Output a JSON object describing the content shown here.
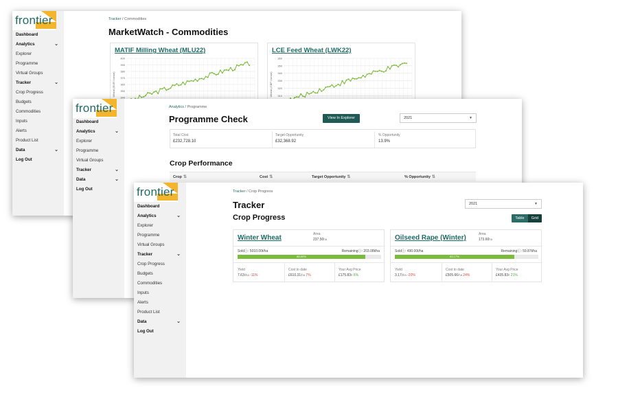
{
  "brand": {
    "logo_text": "frontier"
  },
  "window1": {
    "breadcrumb": {
      "parent": "Tracker",
      "separator": "/",
      "current": "Commodities"
    },
    "title": "MarketWatch - Commodities",
    "charts": [
      {
        "title": "MATIF Milling Wheat (MLU22)",
        "ylabel": "Wheat (EUR / tonne)",
        "yticks": [
          "400",
          "390",
          "380",
          "370",
          "360",
          "350",
          "340",
          "330",
          "320"
        ]
      },
      {
        "title": "LCE Feed Wheat (LWK22)",
        "ylabel": "Wheat (GBP / tonne)",
        "yticks": [
          "360",
          "350",
          "340",
          "330",
          "320",
          "310",
          "300",
          "290"
        ]
      }
    ],
    "nav": [
      {
        "label": "Dashboard",
        "bold": true,
        "chevron": false
      },
      {
        "label": "Analytics",
        "bold": true,
        "chevron": true
      },
      {
        "label": "Explorer",
        "bold": false,
        "chevron": false
      },
      {
        "label": "Programme",
        "bold": false,
        "chevron": false
      },
      {
        "label": "Virtual Groups",
        "bold": false,
        "chevron": false
      },
      {
        "label": "Tracker",
        "bold": true,
        "chevron": true
      },
      {
        "label": "Crop Progress",
        "bold": false,
        "chevron": false
      },
      {
        "label": "Budgets",
        "bold": false,
        "chevron": false
      },
      {
        "label": "Commodities",
        "bold": false,
        "chevron": false
      },
      {
        "label": "Inputs",
        "bold": false,
        "chevron": false
      },
      {
        "label": "Alerts",
        "bold": false,
        "chevron": false
      },
      {
        "label": "Product List",
        "bold": false,
        "chevron": false
      },
      {
        "label": "Data",
        "bold": true,
        "chevron": true
      },
      {
        "label": "Log Out",
        "bold": true,
        "chevron": false
      }
    ]
  },
  "window2": {
    "breadcrumb": {
      "parent": "Analytics",
      "separator": "/",
      "current": "Programme"
    },
    "title": "Programme Check",
    "view_button": "View In Explorer",
    "year_select": "2021",
    "stats": [
      {
        "label": "Total Cost",
        "value": "£232,728.10"
      },
      {
        "label": "Target Opportunity",
        "value": "£32,368.92"
      },
      {
        "label": "% Opportunity",
        "value": "13.9%"
      }
    ],
    "section_title": "Crop Performance",
    "table_headers": [
      "Crop",
      "Cost",
      "Target Opportunity",
      "% Opportunity"
    ],
    "nav": [
      {
        "label": "Dashboard",
        "bold": true,
        "chevron": false
      },
      {
        "label": "Analytics",
        "bold": true,
        "chevron": true
      },
      {
        "label": "Explorer",
        "bold": false,
        "chevron": false
      },
      {
        "label": "Programme",
        "bold": false,
        "chevron": false
      },
      {
        "label": "Virtual Groups",
        "bold": false,
        "chevron": false
      },
      {
        "label": "Tracker",
        "bold": true,
        "chevron": true
      },
      {
        "label": "Data",
        "bold": true,
        "chevron": true
      },
      {
        "label": "Log Out",
        "bold": true,
        "chevron": false
      }
    ]
  },
  "window3": {
    "breadcrumb": {
      "parent": "Tracker",
      "separator": "/",
      "current": "Crop Progress"
    },
    "title": "Tracker",
    "subtitle": "Crop Progress",
    "year_select": "2021",
    "view_toggle": {
      "table": "Table",
      "grid": "Grid"
    },
    "crops": [
      {
        "name": "Winter Wheat",
        "area_label": "Area",
        "area_value": "237.50",
        "area_unit": "ha",
        "sold_label": "Sold",
        "sold_value": ": 5010.00t/ha",
        "remaining_label": "Remaining",
        "remaining_value": ": 203.08t/ha",
        "progress_text": "88.80%",
        "progress": 0.888,
        "metrics": [
          {
            "label": "Yield",
            "value": "7.63",
            "unit": "t/ha",
            "change": "-11%",
            "dir": "neg"
          },
          {
            "label": "Cost to date",
            "value": "£610.31",
            "unit": "/ha",
            "change": "7%",
            "dir": "neg"
          },
          {
            "label": "Your Avg Price",
            "value": "£175.83",
            "unit": "/t",
            "change": "6%",
            "dir": "pos"
          }
        ]
      },
      {
        "name": "Oilseed Rape (Winter)",
        "area_label": "Area",
        "area_value": "173.60",
        "area_unit": "ha",
        "sold_label": "Sold",
        "sold_value": ": 490.00t/ha",
        "remaining_label": "Remaining",
        "remaining_value": ": 59.87t/ha",
        "progress_text": "83.17%",
        "progress": 0.8317,
        "metrics": [
          {
            "label": "Yield",
            "value": "3.17",
            "unit": "t/ha",
            "change": "-20%",
            "dir": "neg"
          },
          {
            "label": "Cost to date",
            "value": "£505.66",
            "unit": "/ha",
            "change": "24%",
            "dir": "neg"
          },
          {
            "label": "Your Avg Price",
            "value": "£435.83",
            "unit": "/t",
            "change": "21%",
            "dir": "pos"
          }
        ]
      }
    ],
    "nav": [
      {
        "label": "Dashboard",
        "bold": true,
        "chevron": false
      },
      {
        "label": "Analytics",
        "bold": true,
        "chevron": true
      },
      {
        "label": "Explorer",
        "bold": false,
        "chevron": false
      },
      {
        "label": "Programme",
        "bold": false,
        "chevron": false
      },
      {
        "label": "Virtual Groups",
        "bold": false,
        "chevron": false
      },
      {
        "label": "Tracker",
        "bold": true,
        "chevron": true
      },
      {
        "label": "Crop Progress",
        "bold": false,
        "chevron": false
      },
      {
        "label": "Budgets",
        "bold": false,
        "chevron": false
      },
      {
        "label": "Commodities",
        "bold": false,
        "chevron": false
      },
      {
        "label": "Inputs",
        "bold": false,
        "chevron": false
      },
      {
        "label": "Alerts",
        "bold": false,
        "chevron": false
      },
      {
        "label": "Product List",
        "bold": false,
        "chevron": false
      },
      {
        "label": "Data",
        "bold": true,
        "chevron": true
      },
      {
        "label": "Log Out",
        "bold": true,
        "chevron": false
      }
    ]
  },
  "colors": {
    "brand_teal": "#1f6b66",
    "brand_gold": "#f4b52e",
    "progress_green": "#7dbb3c",
    "button_dark": "#1f5a55",
    "chart_line": "#7dbb3c"
  }
}
